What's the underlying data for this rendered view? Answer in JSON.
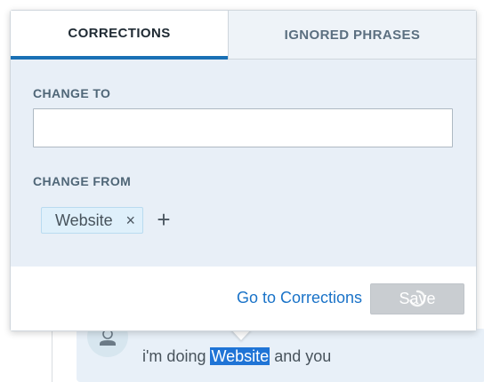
{
  "background": {
    "message": {
      "before": "i'm doing ",
      "highlight": "Website",
      "after": " and you"
    }
  },
  "popup": {
    "tabs": [
      {
        "label": "CORRECTIONS",
        "active": true
      },
      {
        "label": "IGNORED PHRASES",
        "active": false
      }
    ],
    "change_to": {
      "label": "CHANGE TO",
      "value": "",
      "placeholder": ""
    },
    "change_from": {
      "label": "CHANGE FROM",
      "chips": [
        {
          "label": "Website",
          "remove_glyph": "×"
        }
      ],
      "add_glyph": "+"
    },
    "footer": {
      "link_label": "Go to Corrections",
      "save_label": "Save"
    }
  },
  "colors": {
    "accent": "#1a70b5",
    "link": "#1a73c8",
    "form_bg": "#e8eff7",
    "chip_bg": "#dff0fb",
    "highlight": "#1f74d6",
    "disabled_button": "#c9cdd1"
  },
  "icons": [
    "avatar-person-icon",
    "close-icon",
    "plus-icon",
    "loading-spinner-icon"
  ]
}
